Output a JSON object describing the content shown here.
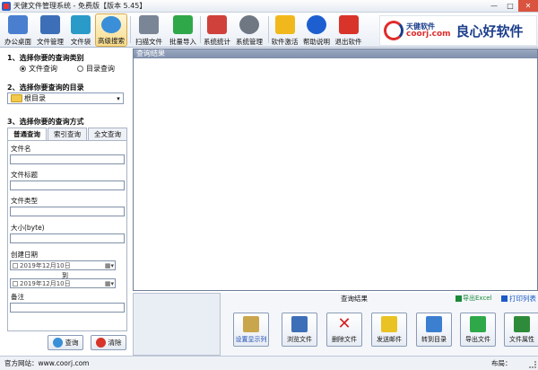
{
  "window": {
    "title": "天健文件管理系统 - 免费版【版本 5.45】"
  },
  "toolbar": {
    "buttons": [
      {
        "label": "办公桌面",
        "icon": "desktop-icon",
        "color": "#4a7fd0"
      },
      {
        "label": "文件管理",
        "icon": "file-manager-icon",
        "color": "#3d6fb8"
      },
      {
        "label": "文件袋",
        "icon": "file-bag-icon",
        "color": "#2a9ac8"
      },
      {
        "label": "高级搜索",
        "icon": "advanced-search-icon",
        "color": "#3a8fd8"
      },
      {
        "label": "扫描文件",
        "icon": "scanner-icon",
        "color": "#7a8596"
      },
      {
        "label": "批量导入",
        "icon": "batch-import-icon",
        "color": "#2fa84a"
      },
      {
        "label": "系统统计",
        "icon": "statistics-icon",
        "color": "#d0413b"
      },
      {
        "label": "系统管理",
        "icon": "system-settings-icon",
        "color": "#6f7783"
      },
      {
        "label": "软件激活",
        "icon": "activate-icon",
        "color": "#f1b81e"
      },
      {
        "label": "帮助说明",
        "icon": "help-icon",
        "color": "#1d5fd0"
      },
      {
        "label": "退出软件",
        "icon": "exit-icon",
        "color": "#d8342a"
      }
    ]
  },
  "brand": {
    "name": "天健软件",
    "url": "coorj.com",
    "slogan": "良心好软件"
  },
  "search": {
    "section1": "1、选择你要的查询类别",
    "type_options": [
      {
        "label": "文件查询",
        "selected": true
      },
      {
        "label": "目录查询",
        "selected": false
      }
    ],
    "section2": "2、选择你要查询的目录",
    "directory": "根目录",
    "section3": "3、选择你要的查询方式",
    "tabs": [
      {
        "label": "普通查询",
        "active": true
      },
      {
        "label": "索引查询",
        "active": false
      },
      {
        "label": "全文查询",
        "active": false
      }
    ],
    "fields": {
      "filename": "文件名",
      "title": "文件标题",
      "type": "文件类型",
      "size": "大小(byte)",
      "created": "创建日期",
      "note": "备注"
    },
    "date_from": "2019年12月10日",
    "date_to_label": "到",
    "date_to": "2019年12月10日",
    "query_button": "查询",
    "clear_button": "清除"
  },
  "results": {
    "header": "查询结果"
  },
  "bottom": {
    "title": "查询结果",
    "export_excel": "导出Excel",
    "print_list": "打印列表",
    "actions": [
      {
        "label": "设置显示列",
        "icon": "columns-icon",
        "color": "#c9a54c",
        "blue": true
      },
      {
        "label": "浏览文件",
        "icon": "browse-icon",
        "color": "#3d6fb8",
        "blue": false
      },
      {
        "label": "删除文件",
        "icon": "delete-icon",
        "color": "#d32222",
        "blue": false
      },
      {
        "label": "发送邮件",
        "icon": "mail-icon",
        "color": "#e9c224",
        "blue": false
      },
      {
        "label": "转到目录",
        "icon": "goto-folder-icon",
        "color": "#3b7fd0",
        "blue": false
      },
      {
        "label": "导出文件",
        "icon": "export-icon",
        "color": "#2fa84a",
        "blue": false
      },
      {
        "label": "文件属性",
        "icon": "properties-icon",
        "color": "#2e8b3a",
        "blue": false
      }
    ]
  },
  "status": {
    "website": "官方网站：www.coorj.com",
    "layout": "布局："
  }
}
